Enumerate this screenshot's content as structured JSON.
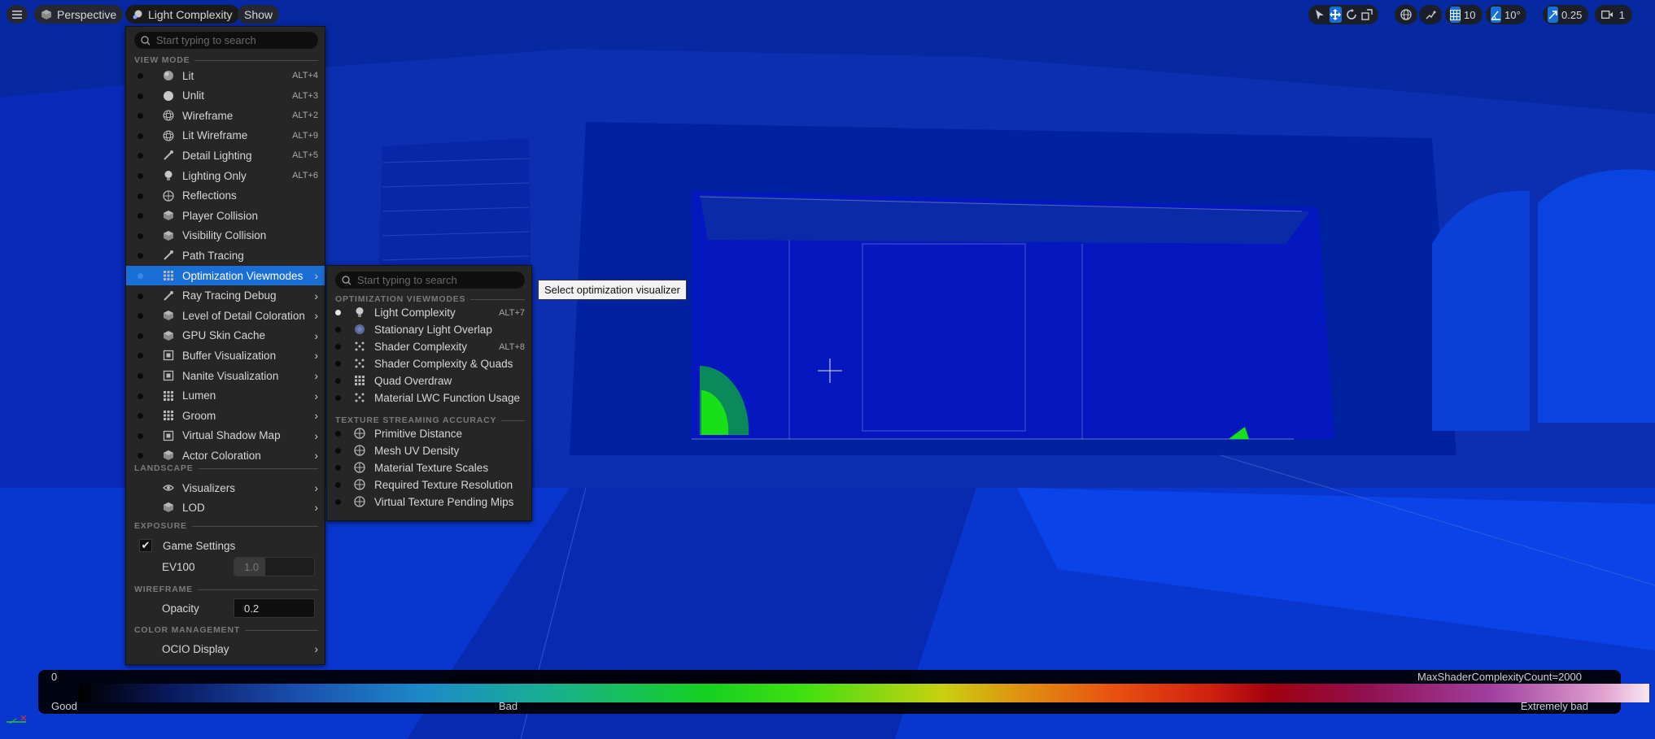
{
  "toolbar": {
    "perspective_label": "Perspective",
    "viewmode_label": "Light Complexity",
    "show_label": "Show",
    "grid_size": "10",
    "rotation_snap": "10°",
    "scale_snap": "0.25",
    "camera_speed": "1"
  },
  "main_menu": {
    "search_placeholder": "Start typing to search",
    "sections": {
      "view_mode": "VIEW MODE",
      "landscape": "LANDSCAPE",
      "exposure": "EXPOSURE",
      "wireframe": "WIREFRAME",
      "color_management": "COLOR MANAGEMENT"
    },
    "view_modes": [
      {
        "label": "Lit",
        "shortcut": "ALT+4"
      },
      {
        "label": "Unlit",
        "shortcut": "ALT+3"
      },
      {
        "label": "Wireframe",
        "shortcut": "ALT+2"
      },
      {
        "label": "Lit Wireframe",
        "shortcut": "ALT+9"
      },
      {
        "label": "Detail Lighting",
        "shortcut": "ALT+5"
      },
      {
        "label": "Lighting Only",
        "shortcut": "ALT+6"
      },
      {
        "label": "Reflections",
        "shortcut": ""
      },
      {
        "label": "Player Collision",
        "shortcut": ""
      },
      {
        "label": "Visibility Collision",
        "shortcut": ""
      },
      {
        "label": "Path Tracing",
        "shortcut": ""
      },
      {
        "label": "Optimization Viewmodes",
        "shortcut": ""
      },
      {
        "label": "Ray Tracing Debug",
        "shortcut": ""
      },
      {
        "label": "Level of Detail Coloration",
        "shortcut": ""
      },
      {
        "label": "GPU Skin Cache",
        "shortcut": ""
      },
      {
        "label": "Buffer Visualization",
        "shortcut": ""
      },
      {
        "label": "Nanite Visualization",
        "shortcut": ""
      },
      {
        "label": "Lumen",
        "shortcut": ""
      },
      {
        "label": "Groom",
        "shortcut": ""
      },
      {
        "label": "Virtual Shadow Map",
        "shortcut": ""
      },
      {
        "label": "Actor Coloration",
        "shortcut": ""
      }
    ],
    "landscape_items": [
      {
        "label": "Visualizers"
      },
      {
        "label": "LOD"
      }
    ],
    "exposure": {
      "game_settings_label": "Game Settings",
      "game_settings_checked": true,
      "ev100_label": "EV100",
      "ev100_value": "1.0"
    },
    "wireframe": {
      "opacity_label": "Opacity",
      "opacity_value": "0.2"
    },
    "ocio_label": "OCIO Display"
  },
  "sub_menu": {
    "search_placeholder": "Start typing to search",
    "sections": {
      "optimization": "OPTIMIZATION VIEWMODES",
      "texture_streaming": "TEXTURE STREAMING ACCURACY"
    },
    "optimization_items": [
      {
        "label": "Light Complexity",
        "shortcut": "ALT+7",
        "selected": true
      },
      {
        "label": "Stationary Light Overlap",
        "shortcut": "",
        "selected": false
      },
      {
        "label": "Shader Complexity",
        "shortcut": "ALT+8",
        "selected": false
      },
      {
        "label": "Shader Complexity & Quads",
        "shortcut": "",
        "selected": false
      },
      {
        "label": "Quad Overdraw",
        "shortcut": "",
        "selected": false
      },
      {
        "label": "Material LWC Function Usage",
        "shortcut": "",
        "selected": false
      }
    ],
    "texture_items": [
      {
        "label": "Primitive Distance"
      },
      {
        "label": "Mesh UV Density"
      },
      {
        "label": "Material Texture Scales"
      },
      {
        "label": "Required Texture Resolution"
      },
      {
        "label": "Virtual Texture Pending Mips"
      }
    ]
  },
  "tooltip": "Select optimization visualizer",
  "legend": {
    "min_label": "0",
    "max_label": "MaxShaderComplexityCount=2000",
    "good_label": "Good",
    "bad_label": "Bad",
    "extremely_bad_label": "Extremely bad"
  },
  "colors": {
    "scene_blue": "#0a2a9c",
    "highlight": "#1a6fd6",
    "menu_bg": "#262626"
  }
}
